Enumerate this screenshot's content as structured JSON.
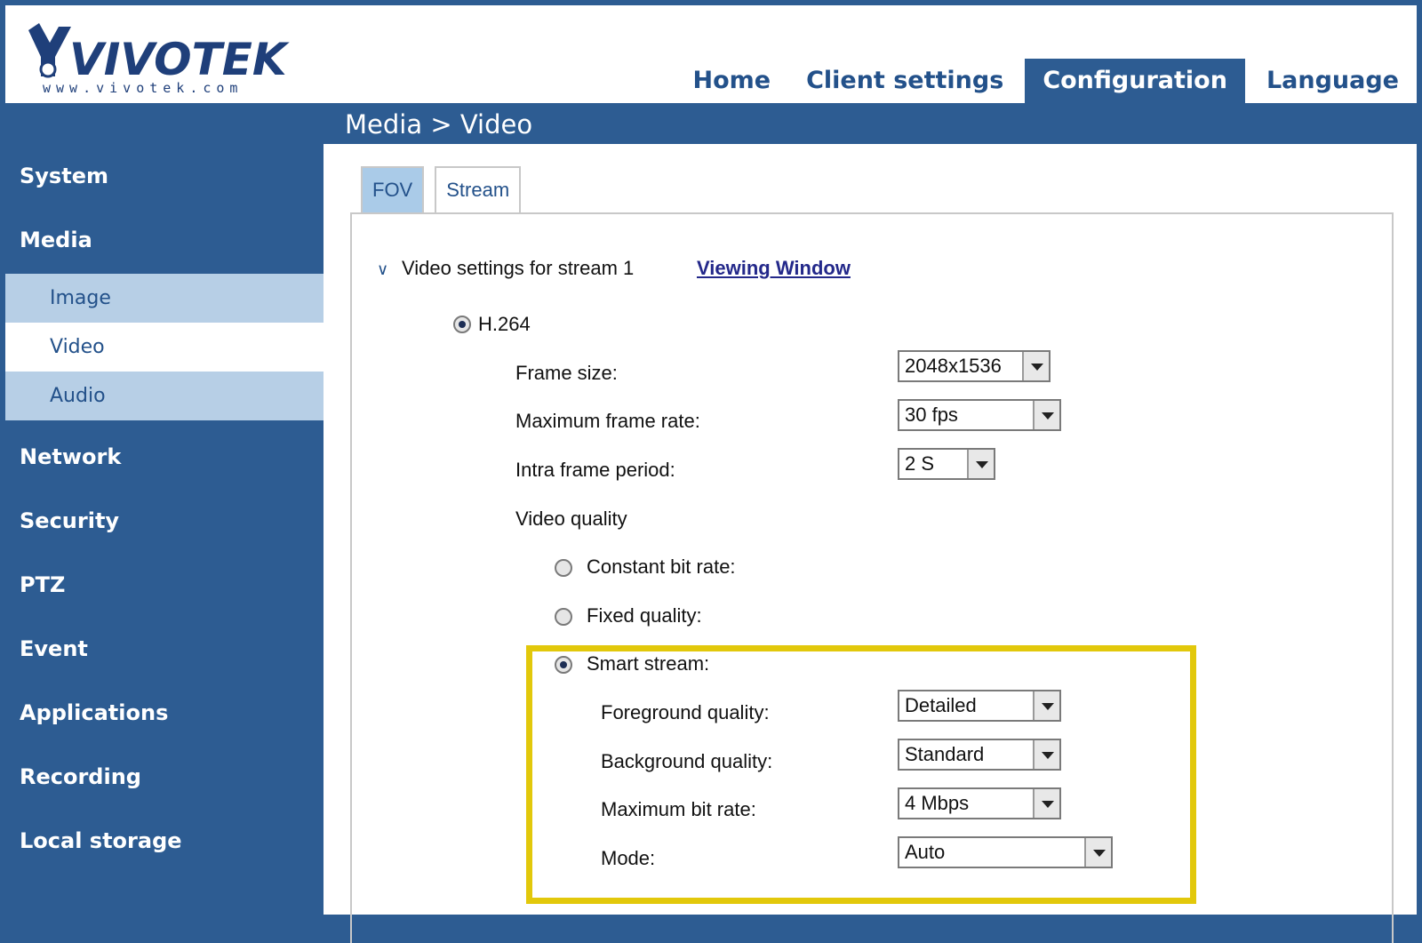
{
  "brand": {
    "name": "VIVOTEK",
    "website": "www.vivotek.com"
  },
  "nav": {
    "items": [
      "Home",
      "Client settings",
      "Configuration",
      "Language"
    ],
    "active": "Configuration"
  },
  "breadcrumb": "Media  > Video",
  "sidebar": {
    "items": [
      "System",
      "Media",
      "Network",
      "Security",
      "PTZ",
      "Event",
      "Applications",
      "Recording",
      "Local storage"
    ],
    "media_sub": [
      "Image",
      "Video",
      "Audio"
    ],
    "current_sub": "Video"
  },
  "tabs": [
    "FOV",
    "Stream"
  ],
  "active_tab": "FOV",
  "stream": {
    "heading": "Video settings for stream 1",
    "viewing_window_link": "Viewing Window",
    "codec": "H.264",
    "frame_size_label": "Frame size:",
    "frame_size": "2048x1536",
    "max_frame_rate_label": "Maximum frame rate:",
    "max_frame_rate": "30 fps",
    "intra_frame_label": "Intra frame period:",
    "intra_frame": "2 S",
    "video_quality_label": "Video quality",
    "cbr_label": "Constant bit rate:",
    "fixed_label": "Fixed quality:",
    "smart_label": "Smart stream:",
    "selected_quality_mode": "Smart stream",
    "fg_quality_label": "Foreground quality:",
    "fg_quality": "Detailed",
    "bg_quality_label": "Background quality:",
    "bg_quality": "Standard",
    "max_bitrate_label": "Maximum bit rate:",
    "max_bitrate": "4 Mbps",
    "mode_label": "Mode:",
    "mode": "Auto"
  },
  "colors": {
    "theme_blue": "#2d5c92",
    "highlight_border": "#e2c80b"
  }
}
